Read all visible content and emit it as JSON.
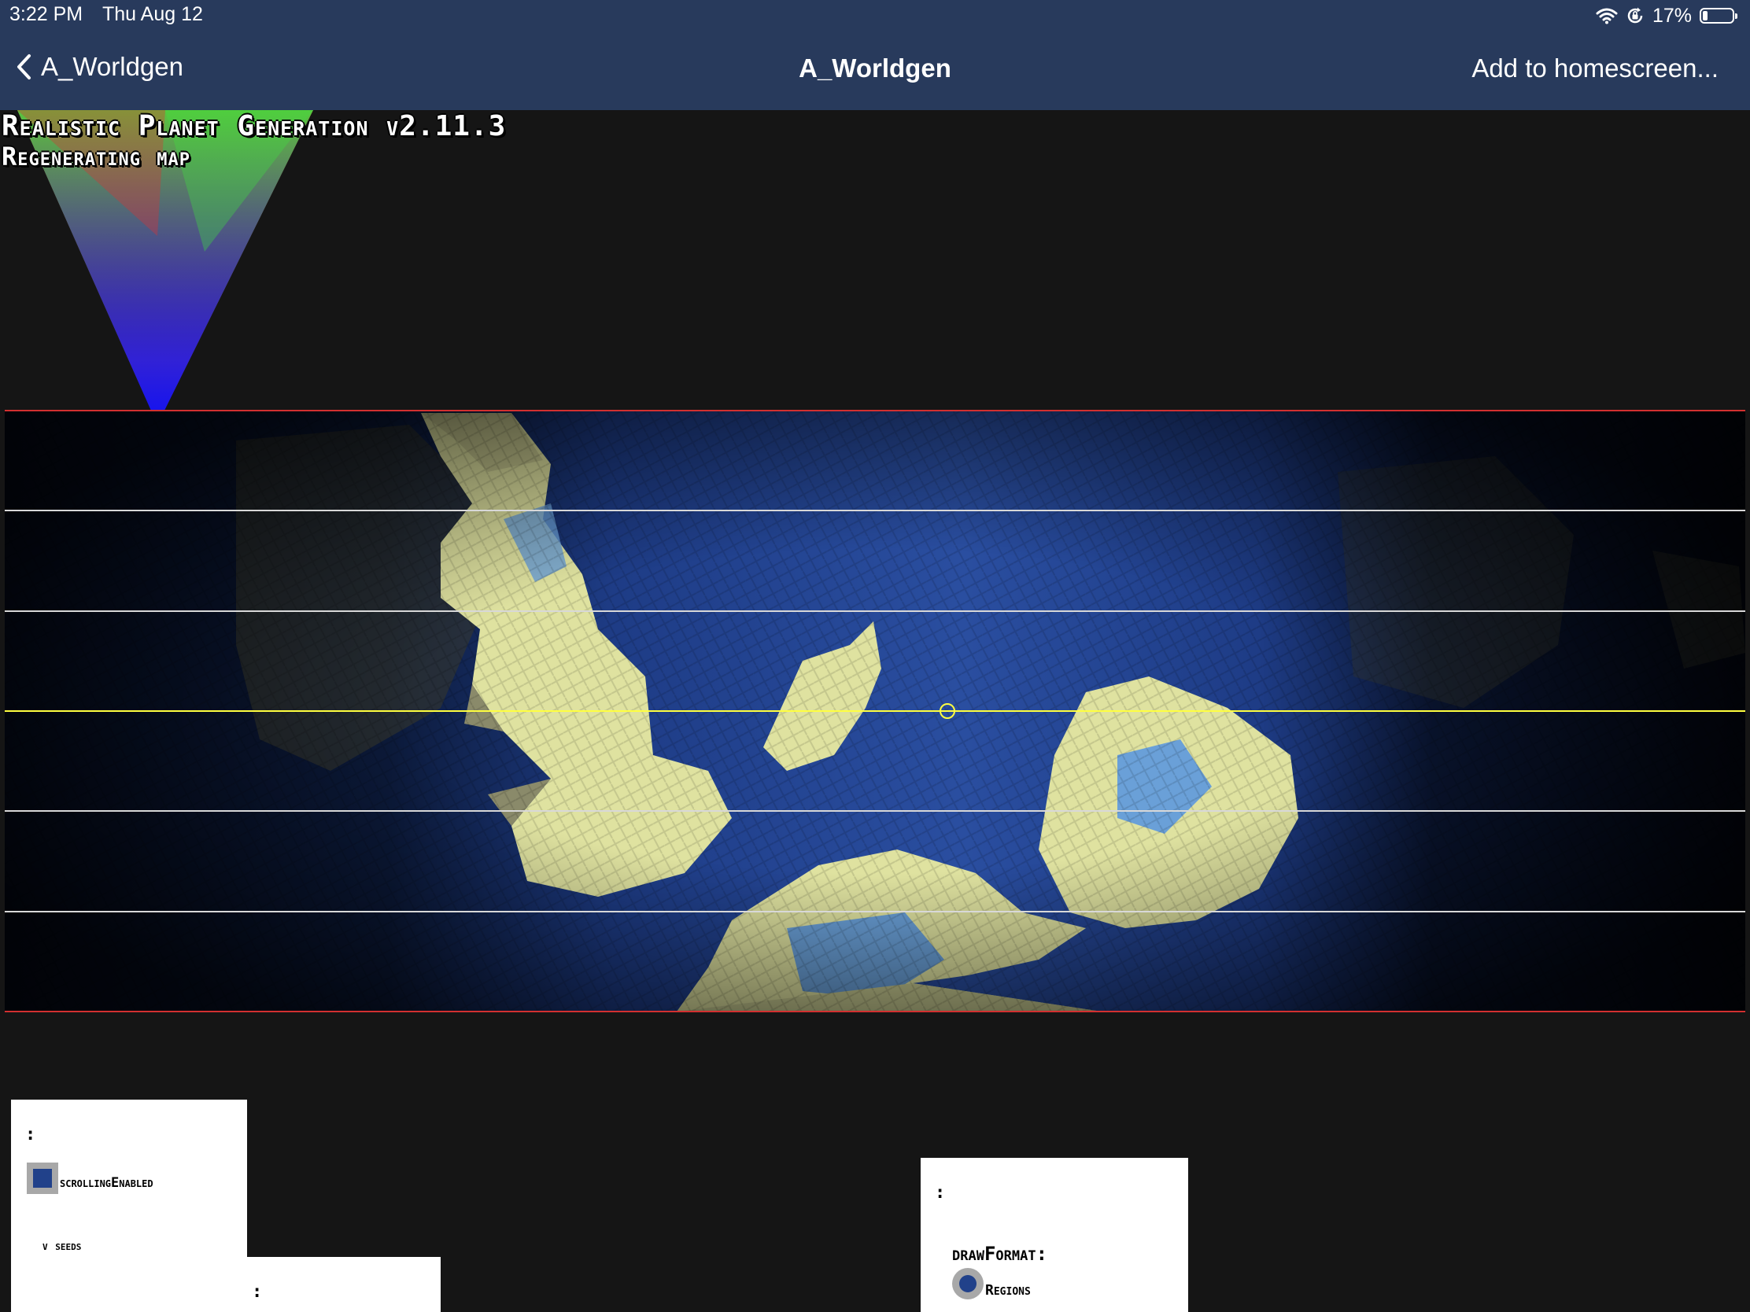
{
  "status_bar": {
    "time": "3:22 PM",
    "date": "Thu Aug 12",
    "battery": "17%",
    "battery_level": 0.17
  },
  "nav": {
    "back_label": "A_Worldgen",
    "title": "A_Worldgen",
    "action_label": "Add to homescreen..."
  },
  "overlay": {
    "title": "Realistic Planet Generation v2.11.3",
    "status": "Regenerating map"
  },
  "controls_left": {
    "colon_top": ":",
    "scrolling_label": "scrollingEnabled",
    "scrolling_checked": true,
    "seeds_label": "v seeds",
    "colon_bottom": ":"
  },
  "controls_right": {
    "colon": ":",
    "draw_format_label": "drawFormat:",
    "regions_label": "Regions",
    "regions_selected": true
  },
  "colors": {
    "nav_bg": "#283a5c",
    "accent_blue": "#21418a",
    "band_red": "#d23030",
    "band_yellow": "#ffff40",
    "ocean": "#1f3f8a",
    "land": "#e3e6a6"
  }
}
